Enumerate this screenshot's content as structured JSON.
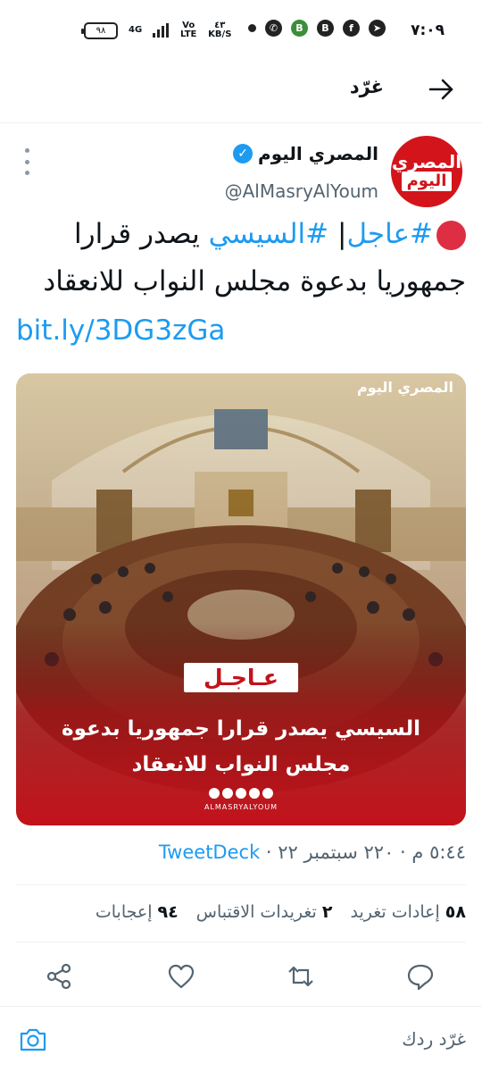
{
  "status_bar": {
    "time": "٧:٠٩",
    "battery": "٩٨",
    "network": "4G",
    "volte": "Vo LTE",
    "speed_value": "٤٣",
    "speed_unit": "KB/S"
  },
  "header": {
    "title": "غرّد"
  },
  "tweet": {
    "display_name": "المصري اليوم",
    "handle": "@AlMasryAlYoum",
    "avatar_text_1": "المصري",
    "avatar_text_2": "اليوم",
    "hashtag_1": "#عاجل",
    "separator": "|",
    "hashtag_2": "#السيسي",
    "text_body": "يصدر قرارا جمهوريا بدعوة مجلس النواب للانعقاد",
    "short_link": "bit.ly/3DG3zGa",
    "media": {
      "logo": "المصري اليوم",
      "badge": "عـاجـل",
      "headline": "السيسي يصدر قرارا جمهوريا بدعوة مجلس النواب للانعقاد",
      "site": "ALMASRYALYOUM"
    },
    "timestamp": "٥:٤٤ م · ٢٢٠ سبتمبر ٢٢ ·",
    "source": "TweetDeck",
    "stats": {
      "retweets_count": "٥٨",
      "retweets_label": "إعادات تغريد",
      "quotes_count": "٢",
      "quotes_label": "تغريدات الاقتباس",
      "likes_count": "٩٤",
      "likes_label": "إعجابات"
    }
  },
  "reply_bar": {
    "placeholder": "غرّد ردك"
  },
  "colors": {
    "accent": "#1d9bf0",
    "brand_red": "#d3141b",
    "muted": "#536471"
  }
}
